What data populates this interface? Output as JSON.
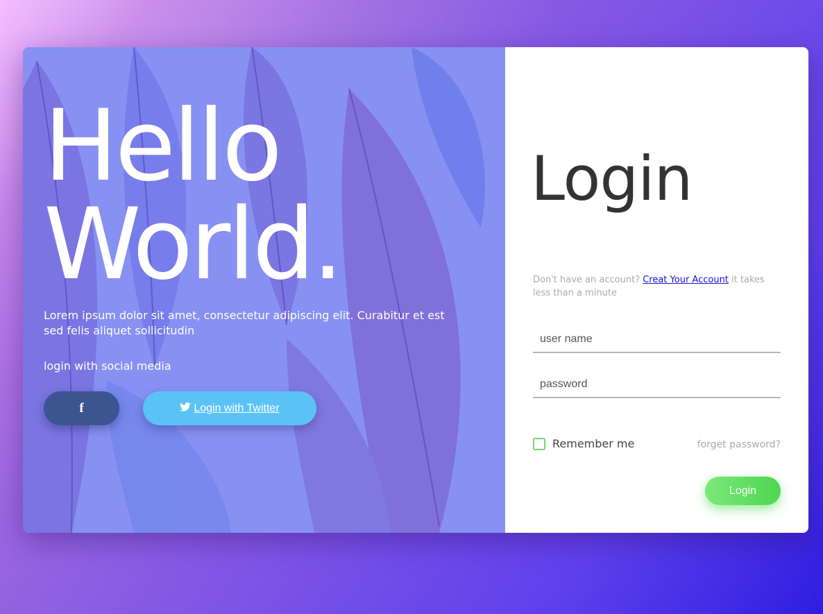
{
  "hero": {
    "line1": "Hello",
    "line2": "World.",
    "description": "Lorem ipsum dolor sit amet, consectetur adipiscing elit. Curabitur et est sed felis aliquet sollicitudin",
    "social_label": "login with social media",
    "facebook_label": "f",
    "twitter_label": "Login with Twitter"
  },
  "login": {
    "title": "Login",
    "signup_prefix": "Don't have an account? ",
    "signup_link": "Creat Your Account",
    "signup_suffix": " it takes less than a minute",
    "username_placeholder": "user name",
    "password_placeholder": "password",
    "remember_label": "Remember me",
    "forget_label": "forget password?",
    "submit_label": "Login"
  },
  "colors": {
    "hero_overlay": "#8791f2",
    "facebook": "#3b5591",
    "twitter": "#5bc2f6",
    "accent_green": "#5bd85b",
    "link": "#1a0dd0"
  },
  "icons": [
    "facebook-icon",
    "twitter-icon"
  ]
}
